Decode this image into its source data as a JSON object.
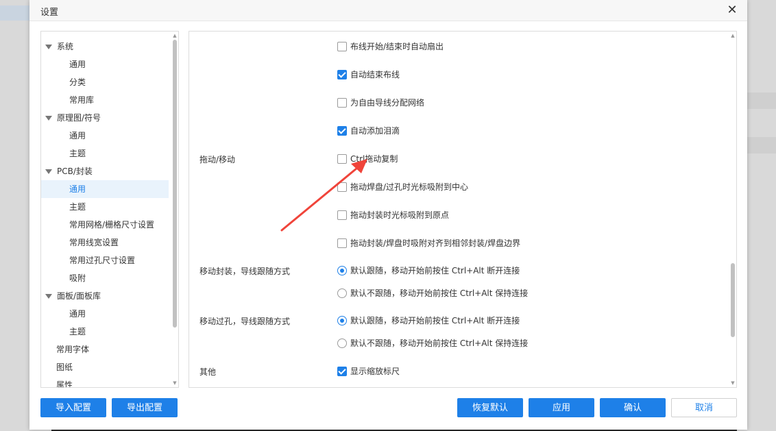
{
  "dialog": {
    "title": "设置"
  },
  "tree": [
    {
      "label": "系统",
      "level": 0,
      "expandable": true
    },
    {
      "label": "通用",
      "level": 1
    },
    {
      "label": "分类",
      "level": 1
    },
    {
      "label": "常用库",
      "level": 1
    },
    {
      "label": "原理图/符号",
      "level": 0,
      "expandable": true
    },
    {
      "label": "通用",
      "level": 1
    },
    {
      "label": "主题",
      "level": 1
    },
    {
      "label": "PCB/封装",
      "level": 0,
      "expandable": true
    },
    {
      "label": "通用",
      "level": 1,
      "selected": true
    },
    {
      "label": "主题",
      "level": 1
    },
    {
      "label": "常用网格/栅格尺寸设置",
      "level": 1
    },
    {
      "label": "常用线宽设置",
      "level": 1
    },
    {
      "label": "常用过孔尺寸设置",
      "level": 1
    },
    {
      "label": "吸附",
      "level": 1
    },
    {
      "label": "面板/面板库",
      "level": 0,
      "expandable": true
    },
    {
      "label": "通用",
      "level": 1
    },
    {
      "label": "主题",
      "level": 1
    },
    {
      "label": "常用字体",
      "level": 0,
      "expandable": false
    },
    {
      "label": "图纸",
      "level": 0,
      "expandable": false
    },
    {
      "label": "属性",
      "level": 0,
      "expandable": false
    }
  ],
  "content": {
    "rows": [
      {
        "section": "",
        "type": "checkbox",
        "checked": false,
        "label": "布线开始/结束时自动扇出"
      },
      {
        "section": "",
        "type": "checkbox",
        "checked": true,
        "label": "自动结束布线"
      },
      {
        "section": "",
        "type": "checkbox",
        "checked": false,
        "label": "为自由导线分配网络"
      },
      {
        "section": "",
        "type": "checkbox",
        "checked": true,
        "label": "自动添加泪滴"
      },
      {
        "section": "拖动/移动",
        "type": "checkbox",
        "checked": false,
        "label": "Ctrl拖动复制"
      },
      {
        "section": "",
        "type": "checkbox",
        "checked": false,
        "label": "拖动焊盘/过孔时光标吸附到中心"
      },
      {
        "section": "",
        "type": "checkbox",
        "checked": false,
        "label": "拖动封装时光标吸附到原点"
      },
      {
        "section": "",
        "type": "checkbox",
        "checked": false,
        "label": "拖动封装/焊盘时吸附对齐到相邻封装/焊盘边界"
      },
      {
        "section": "移动封装，导线跟随方式",
        "type": "radio",
        "checked": true,
        "label": "默认跟随，移动开始前按住 Ctrl+Alt 断开连接"
      },
      {
        "section": "",
        "type": "radio",
        "checked": false,
        "label": "默认不跟随，移动开始前按住 Ctrl+Alt 保持连接"
      },
      {
        "section": "移动过孔，导线跟随方式",
        "type": "radio",
        "checked": true,
        "label": "默认跟随，移动开始前按住 Ctrl+Alt 断开连接"
      },
      {
        "section": "",
        "type": "radio",
        "checked": false,
        "label": "默认不跟随，移动开始前按住 Ctrl+Alt 保持连接"
      },
      {
        "section": "其他",
        "type": "checkbox",
        "checked": true,
        "label": "显示缩放标尺"
      }
    ]
  },
  "footer": {
    "import_label": "导入配置",
    "export_label": "导出配置",
    "restore_label": "恢复默认",
    "apply_label": "应用",
    "confirm_label": "确认",
    "cancel_label": "取消"
  },
  "colors": {
    "accent": "#1e80e8",
    "selected_bg": "#e9f3fc",
    "arrow": "#f0443a"
  },
  "icons": {
    "close": "close-icon",
    "expand": "caret-down-icon"
  }
}
